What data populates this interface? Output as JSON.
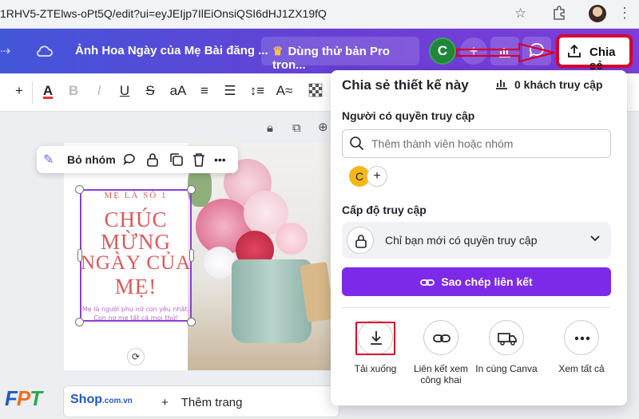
{
  "browser": {
    "url": "1RHV5-ZTElws-oPt5Q/edit?ui=eyJEIjp7IlEiOnsiQSI6dHJ1ZX19fQ",
    "star_icon": "star-icon",
    "extensions_icon": "puzzle-icon",
    "menu_icon": "kebab-icon"
  },
  "header": {
    "design_title": "Ảnh Hoa Ngày của Mẹ Bài đăng ...",
    "trial_label": "Dùng thử bản Pro tron...",
    "user_initial": "C",
    "share_label": "Chia sẻ",
    "colors": {
      "accent": "#7d2ae8",
      "gradient_start": "#4256d8",
      "gradient_end": "#7c3dd8",
      "highlight": "#d8002e"
    }
  },
  "toolbar": {
    "plus": "+",
    "text_color": "A",
    "bold": "B",
    "italic": "I",
    "underline": "U",
    "strike": "S",
    "case": "aA",
    "spacing_symbol": "≡",
    "line_height_symbol": "↕≡",
    "effects": "A≈"
  },
  "context_bar": {
    "ungroup_label": "Bỏ nhóm",
    "more": "•••"
  },
  "design": {
    "small_heading": "MẸ LÀ SỐ 1",
    "line1": "CHÚC",
    "line2": "MỪNG",
    "line3": "NGÀY CỦA",
    "line4": "MẸ!",
    "foot1": "Mẹ là người phụ nữ con yêu nhất.",
    "foot2": "Con nợ mẹ tất cả mọi thứ!"
  },
  "add_page": {
    "plus": "+",
    "label": "Thêm trang"
  },
  "watermark": {
    "brand_f": "F",
    "brand_p": "P",
    "brand_t": "T",
    "shop": "Shop",
    "domain": ".com.vn"
  },
  "share_panel": {
    "title": "Chia sẻ thiết kế này",
    "visitors": "0 khách truy cập",
    "people_label": "Người có quyền truy cập",
    "search_placeholder": "Thêm thành viên hoặc nhóm",
    "member_initial": "C",
    "member_add": "+",
    "access_label": "Cấp độ truy cập",
    "access_value": "Chỉ bạn mới có quyền truy cập",
    "copy_link": "Sao chép liên kết",
    "actions": [
      {
        "label": "Tải xuống",
        "icon": "download-icon"
      },
      {
        "label": "Liên kết xem công khai",
        "icon": "link-icon"
      },
      {
        "label": "In cùng Canva",
        "icon": "truck-icon"
      },
      {
        "label": "Xem tất cả",
        "icon": "more-icon"
      }
    ]
  }
}
